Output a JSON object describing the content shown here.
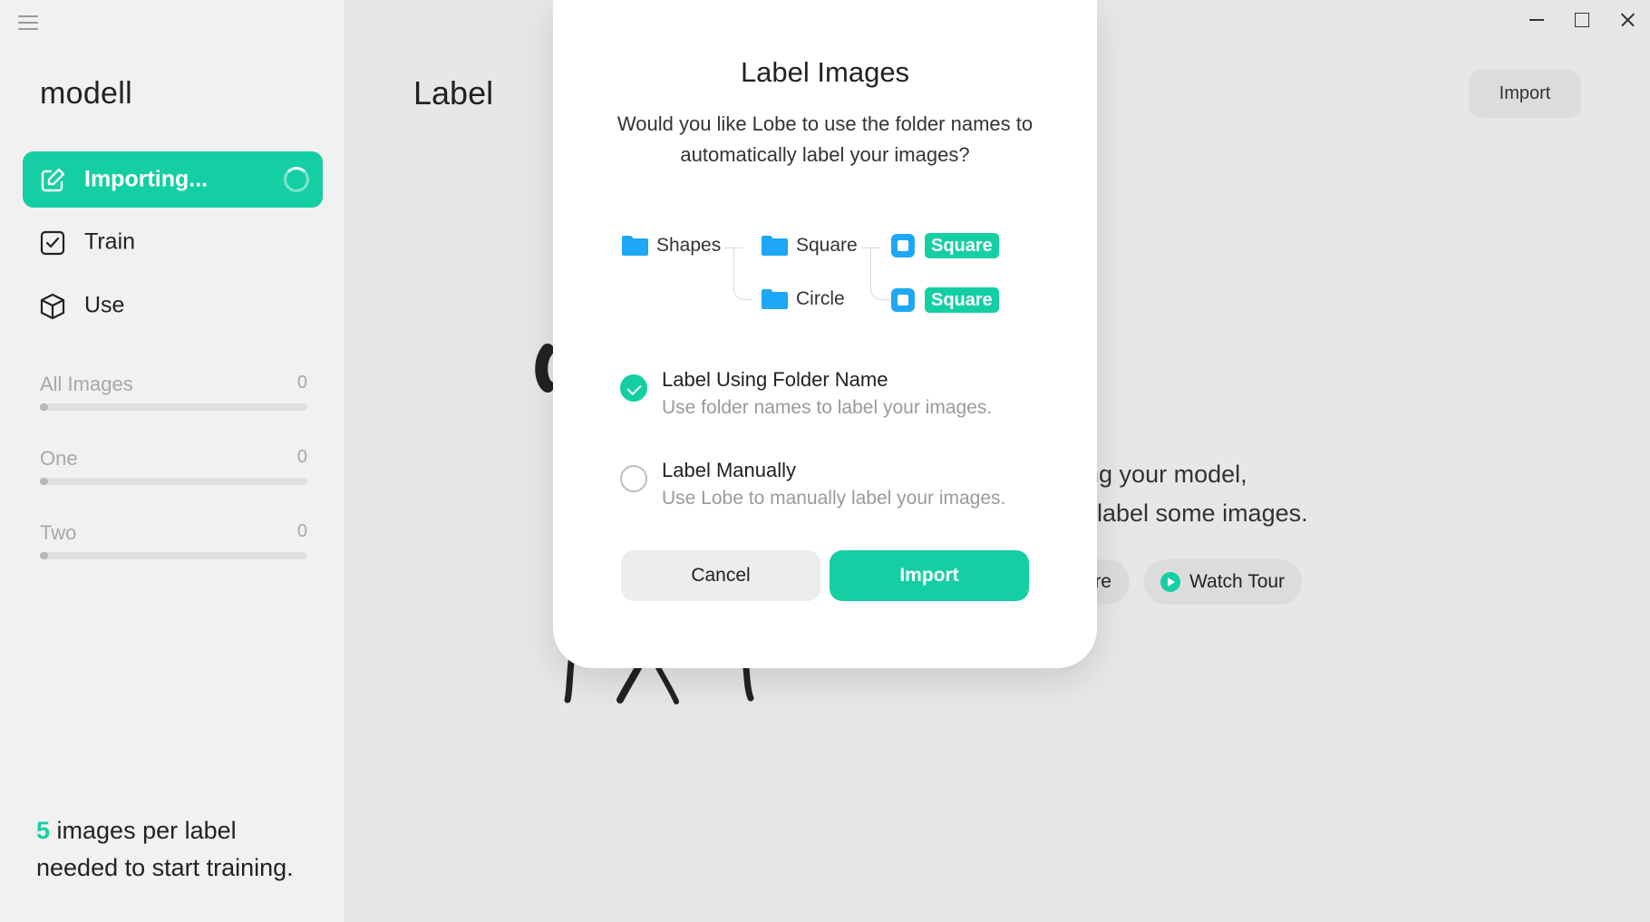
{
  "sidebar": {
    "project_name": "modell",
    "nav": [
      {
        "label": "Importing...",
        "icon": "edit-icon",
        "active": true
      },
      {
        "label": "Train",
        "icon": "checkbox-icon",
        "active": false
      },
      {
        "label": "Use",
        "icon": "cube-icon",
        "active": false
      }
    ],
    "labels": [
      {
        "name": "All Images",
        "count": "0",
        "progress": 0
      },
      {
        "name": "One",
        "count": "0",
        "progress": 0
      },
      {
        "name": "Two",
        "count": "0",
        "progress": 0
      }
    ],
    "footer": {
      "count": "5",
      "text_line1": " images per label",
      "text_line2": "needed to start training."
    }
  },
  "main": {
    "title": "Label",
    "import_button": "Import",
    "bg_text_line1": "ining your model,",
    "bg_text_line2": "label some images.",
    "more_button": "re",
    "tour_button": "Watch Tour"
  },
  "dialog": {
    "title": "Label Images",
    "description": "Would you like Lobe to use the folder names to automatically label your images?",
    "diagram": {
      "root": "Shapes",
      "children": [
        "Square",
        "Circle"
      ],
      "tags": [
        "Square",
        "Square"
      ]
    },
    "options": [
      {
        "title": "Label Using Folder Name",
        "description": "Use folder names to label your images.",
        "selected": true
      },
      {
        "title": "Label Manually",
        "description": "Use Lobe to manually label your images.",
        "selected": false
      }
    ],
    "cancel_label": "Cancel",
    "import_label": "Import"
  },
  "colors": {
    "accent": "#14cfa4",
    "folder_blue": "#1ea7f5",
    "sidebar_bg": "#f1f1f1",
    "main_bg": "#e7e7e7"
  }
}
